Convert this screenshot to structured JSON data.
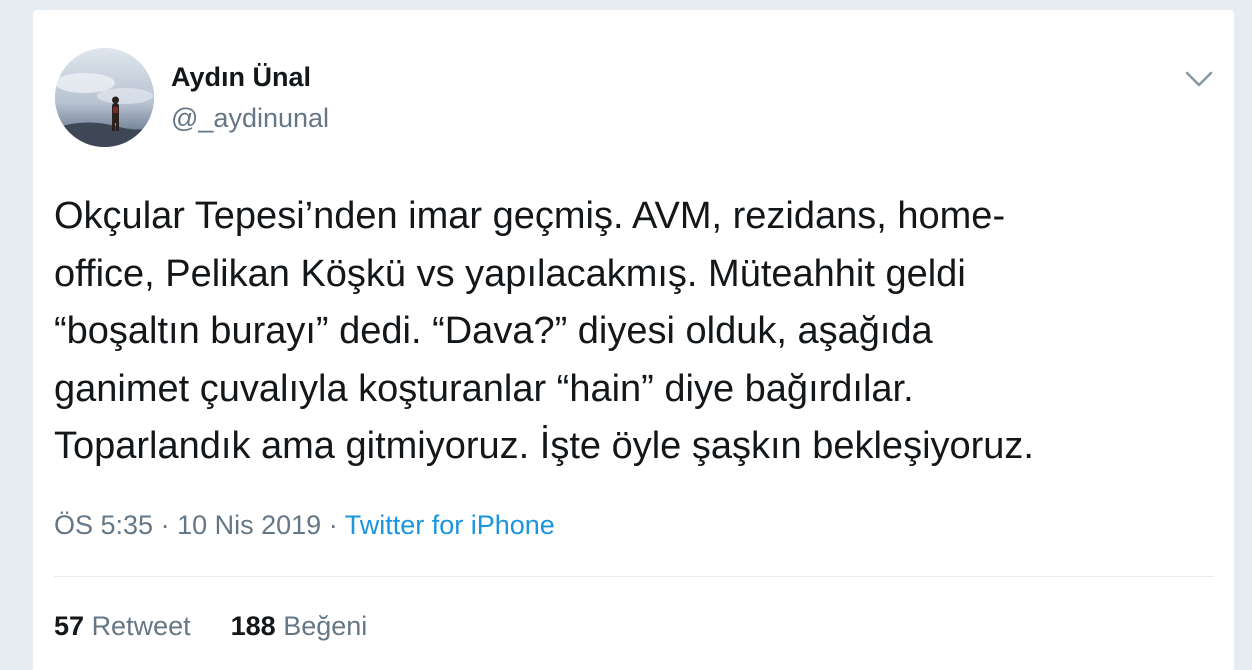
{
  "author": {
    "display_name": "Aydın Ünal",
    "handle": "@_aydinunal"
  },
  "tweet": {
    "text_lines": [
      "Okçular Tepesi’nden imar geçmiş. AVM, rezidans, home-",
      "office, Pelikan Köşkü vs yapılacakmış. Müteahhit geldi",
      "“boşaltın burayı” dedi. “Dava?” diyesi olduk, aşağıda",
      "ganimet çuvalıyla koşturanlar “hain” diye bağırdılar.",
      "Toparlandık ama gitmiyoruz. İşte öyle şaşkın bekleşiyoruz."
    ],
    "time": "ÖS 5:35",
    "separator": "·",
    "date": "10 Nis 2019",
    "source": "Twitter for iPhone"
  },
  "stats": {
    "retweets_count": "57",
    "retweets_label": "Retweet",
    "likes_count": "188",
    "likes_label": "Beğeni"
  },
  "icons": {
    "menu": "chevron-down-icon"
  },
  "colors": {
    "background": "#e6ecf0",
    "text": "#14171a",
    "secondary": "#657786",
    "link": "#1b95e0"
  }
}
